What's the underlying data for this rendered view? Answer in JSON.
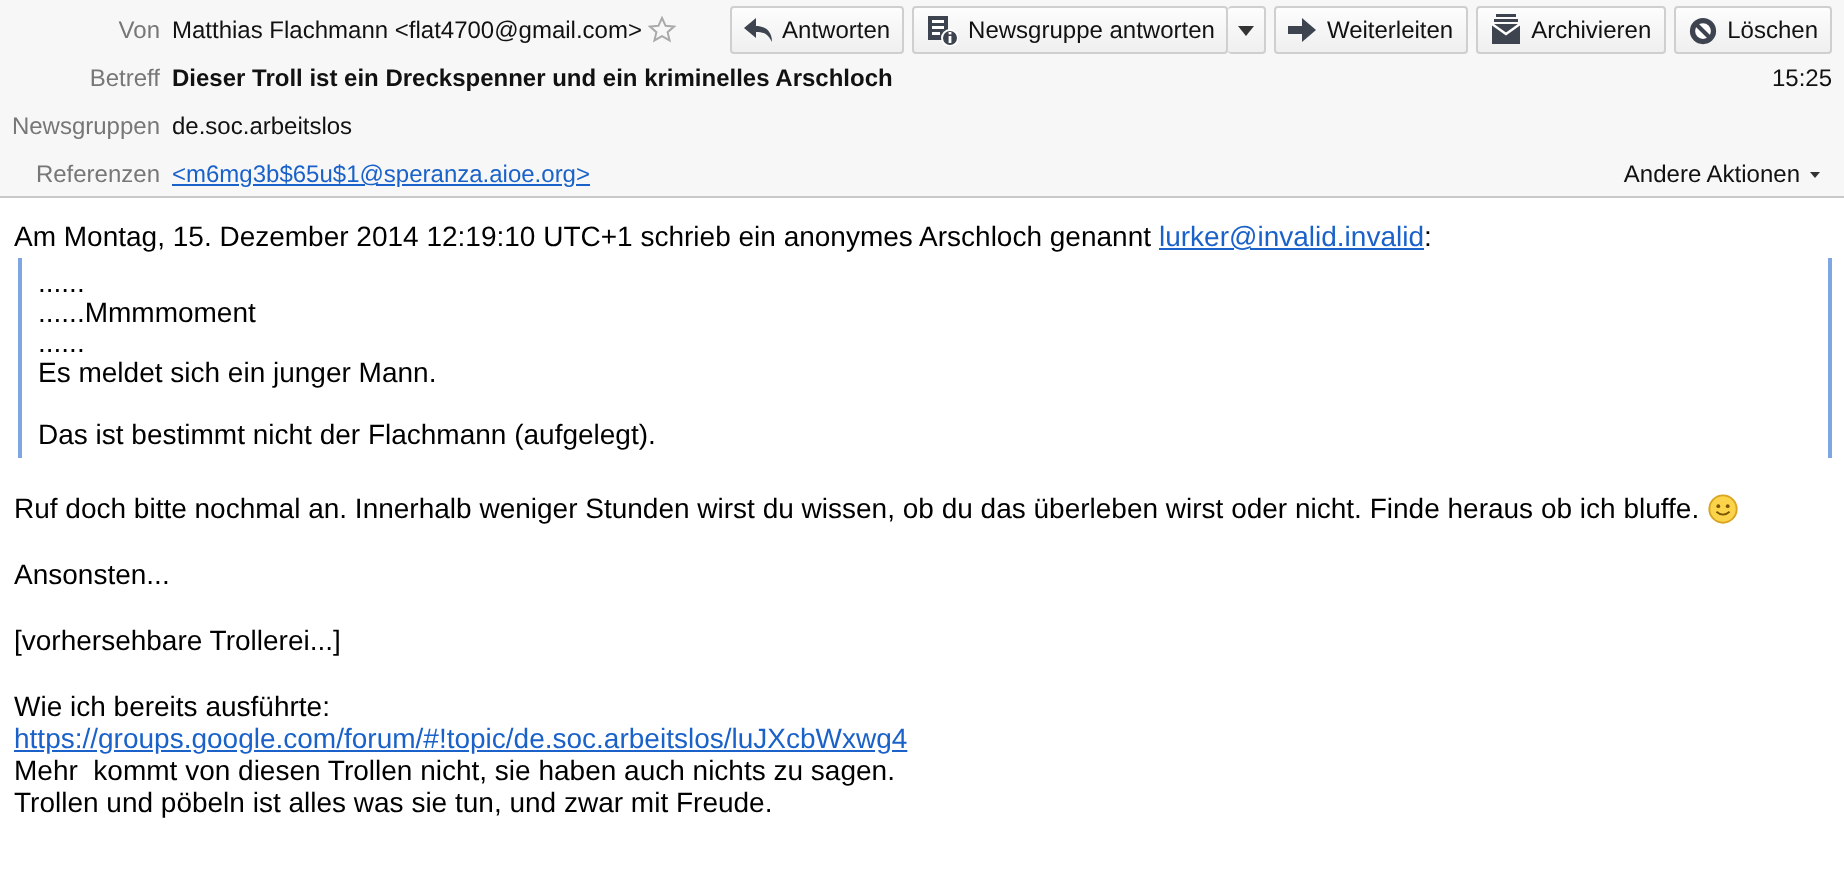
{
  "header": {
    "from": {
      "label": "Von",
      "value": "Matthias Flachmann <flat4700@gmail.com>",
      "starred": false
    },
    "toolbar": [
      {
        "label": "Antworten",
        "kind": "reply",
        "dropdown": false
      },
      {
        "label": "Newsgruppe antworten",
        "kind": "newsgroup",
        "dropdown": true
      },
      {
        "label": "Weiterleiten",
        "kind": "forward",
        "dropdown": false
      },
      {
        "label": "Archivieren",
        "kind": "archive",
        "dropdown": false
      },
      {
        "label": "Löschen",
        "kind": "delete",
        "dropdown": false
      }
    ],
    "subject": {
      "label": "Betreff",
      "value": "Dieser Troll ist ein Dreckspenner und ein kriminelles Arschloch"
    },
    "time": "15:25",
    "newsgroups": {
      "label": "Newsgruppen",
      "value": "de.soc.arbeitslos"
    },
    "references": {
      "label": "Referenzen",
      "value": "<m6mg3b$65u$1@speranza.aioe.org>"
    },
    "other_actions": "Andere Aktionen"
  },
  "body": {
    "attribution": {
      "text": "Am Montag, 15. Dezember 2014 12:19:10 UTC+1 schrieb ein anonymes Arschloch genannt",
      "link": "lurker@invalid.invalid",
      "suffix": ":"
    },
    "quote": [
      [
        "......",
        "......Mmmmoment",
        "......",
        "Es meldet sich ein junger Mann."
      ],
      [
        "Das ist bestimmt nicht der Flachmann (aufgelegt)."
      ]
    ],
    "blocks": [
      {
        "lines": [
          {
            "kind": "text",
            "text": "Ruf doch bitte nochmal an. Innerhalb weniger Stunden wirst du wissen, ob du das überleben wirst oder nicht. Finde heraus ob ich bluffe.",
            "emoji": true
          }
        ]
      },
      {
        "lines": [
          {
            "kind": "text",
            "text": "Ansonsten...",
            "emoji": false
          }
        ]
      },
      {
        "lines": [
          {
            "kind": "text",
            "text": "[vorhersehbare Trollerei...]",
            "emoji": false
          }
        ]
      },
      {
        "lines": [
          {
            "kind": "text",
            "text": "Wie ich bereits ausführte:",
            "emoji": false
          },
          {
            "kind": "link",
            "text": "https://groups.google.com/forum/#!topic/de.soc.arbeitslos/luJXcbWxwg4",
            "emoji": false
          },
          {
            "kind": "text",
            "text": "Mehr  kommt von diesen Trollen nicht, sie haben auch nichts zu sagen.",
            "emoji": false
          },
          {
            "kind": "text",
            "text": "Trollen und pöbeln ist alles was sie tun, und zwar mit Freude.",
            "emoji": false
          }
        ]
      }
    ]
  }
}
